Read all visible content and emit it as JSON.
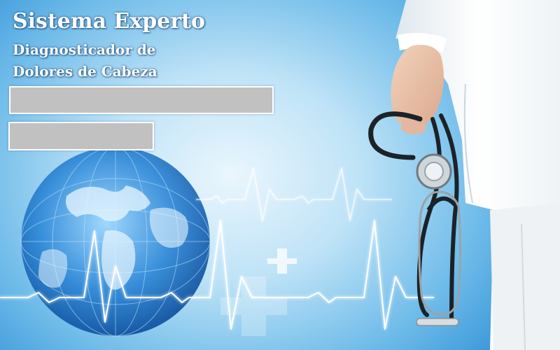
{
  "header": {
    "title": "Sistema Experto",
    "subtitle_line1": "Diagnosticador de",
    "subtitle_line2": "Dolores de Cabeza"
  },
  "fields": [
    {
      "name": "field-1",
      "value": ""
    },
    {
      "name": "field-2",
      "value": ""
    }
  ],
  "theme": {
    "background_accent": "#2f8fd6",
    "field_fill": "#c1c1c1",
    "title_color": "#ffffff"
  },
  "illustration": {
    "icons": [
      "globe-icon",
      "heartbeat-line-icon",
      "medical-cross-icon",
      "doctor-icon",
      "stethoscope-icon"
    ]
  }
}
